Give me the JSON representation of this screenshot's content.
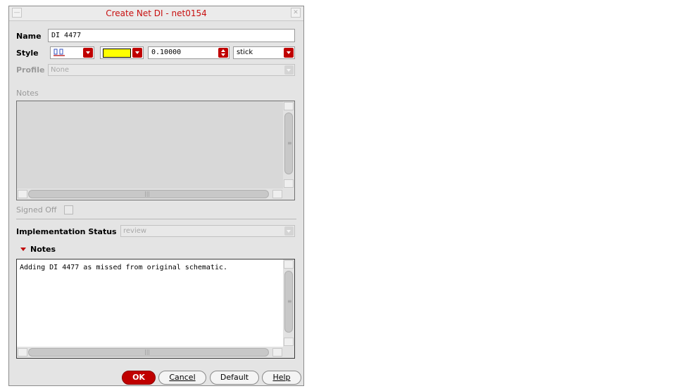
{
  "window": {
    "title": "Create Net DI - net0154",
    "minimize_glyph": "—",
    "close_glyph": "✕"
  },
  "name": {
    "label": "Name",
    "value": "DI 4477"
  },
  "style": {
    "label": "Style",
    "line_pattern_icon": "line-pattern-icon",
    "color": "#ffff00",
    "width_value": "0.10000",
    "render_mode": "stick"
  },
  "profile": {
    "label": "Profile",
    "value": "None"
  },
  "notes_upper": {
    "label": "Notes",
    "text": ""
  },
  "signed_off": {
    "label": "Signed Off",
    "checked": false
  },
  "implementation_status": {
    "label": "Implementation Status",
    "value": "review"
  },
  "notes_section": {
    "label": "Notes",
    "text": "Adding DI 4477 as missed from original schematic."
  },
  "buttons": {
    "ok": "OK",
    "cancel": "Cancel",
    "default": "Default",
    "help": "Help"
  },
  "colors": {
    "accent": "#c00000",
    "title": "#c81010"
  }
}
